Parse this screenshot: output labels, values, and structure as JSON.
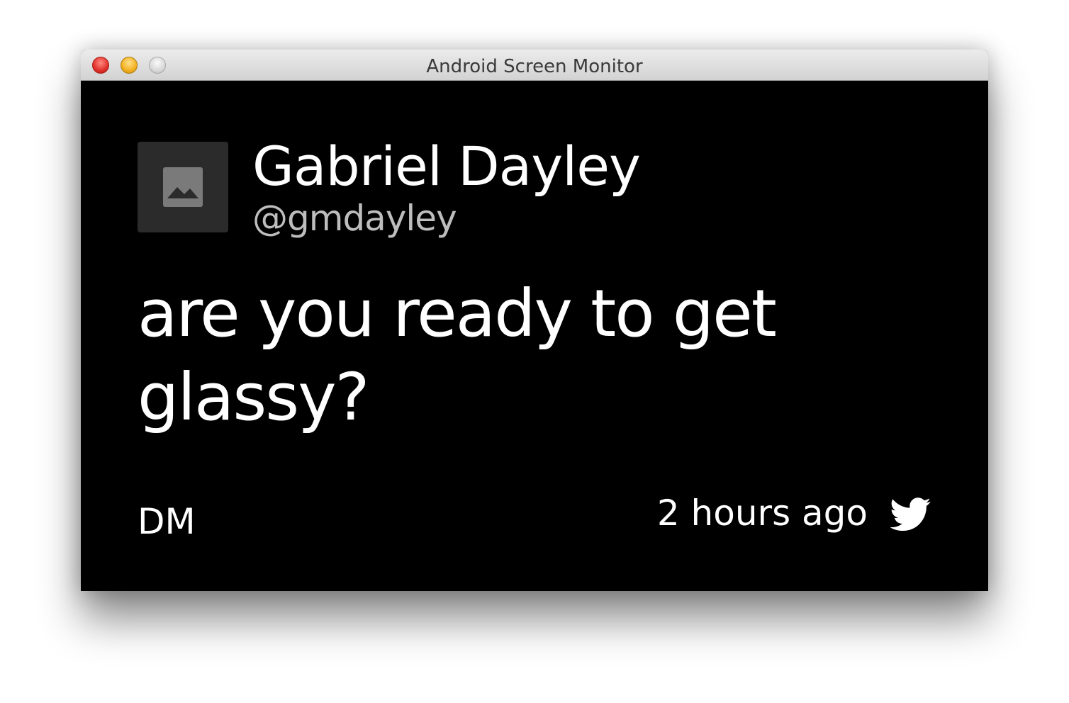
{
  "window": {
    "title": "Android Screen Monitor"
  },
  "card": {
    "name": "Gabriel Dayley",
    "handle": "@gmdayley",
    "message": "are you ready to get glassy?",
    "dm_label": "DM",
    "timestamp": "2 hours ago",
    "source_icon": "twitter-bird-icon"
  },
  "colors": {
    "background": "#000000",
    "text": "#ffffff",
    "handle": "#bdbdbd",
    "avatar_placeholder": "#2b2b2b"
  }
}
